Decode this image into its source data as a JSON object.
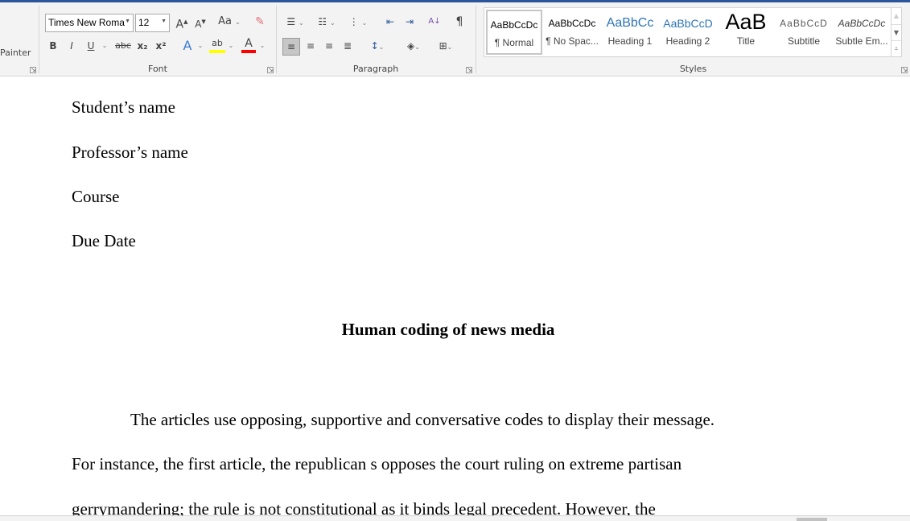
{
  "ribbon": {
    "clipboard": {
      "format_painter_label": "Painter"
    },
    "font": {
      "label": "Font",
      "font_name": "Times New Roma",
      "font_size": "12",
      "change_case": "Aa",
      "buttons": {
        "bold": "B",
        "italic": "I",
        "underline": "U",
        "strike": "abc",
        "sub": "x₂",
        "sup": "x²",
        "text_effects": "A",
        "highlight": "ab",
        "font_color": "A",
        "grow": "A",
        "shrink": "A"
      },
      "highlight_color": "#ffff00",
      "font_color_value": "#ff0000"
    },
    "paragraph": {
      "label": "Paragraph",
      "pilcrow": "¶",
      "sort": "A↓"
    },
    "styles": {
      "label": "Styles",
      "items": [
        {
          "preview": "AaBbCcDc",
          "name": "¶ Normal",
          "selected": true
        },
        {
          "preview": "AaBbCcDc",
          "name": "¶ No Spac..."
        },
        {
          "preview": "AaBbCc",
          "name": "Heading 1"
        },
        {
          "preview": "AaBbCcD",
          "name": "Heading 2"
        },
        {
          "preview": "AaB",
          "name": "Title"
        },
        {
          "preview": "AaBbCcD",
          "name": "Subtitle"
        },
        {
          "preview": "AaBbCcDc",
          "name": "Subtle Em..."
        }
      ]
    }
  },
  "document": {
    "header_lines": [
      "Student’s name",
      "Professor’s name",
      "Course",
      "Due Date"
    ],
    "title": "Human coding of news media",
    "body_lines": [
      "The articles use opposing, supportive and conversative codes to display their message.",
      "For instance, the first article, the republican s opposes the court ruling on extreme partisan",
      "gerrymandering; the rule is not constitutional as it binds legal precedent. However, the"
    ]
  }
}
